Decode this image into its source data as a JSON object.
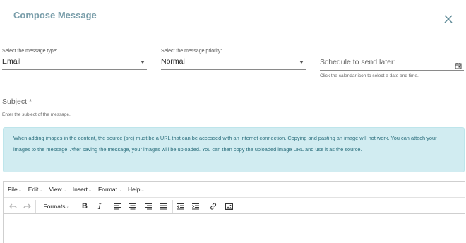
{
  "dialog": {
    "title": "Compose Message"
  },
  "message_type": {
    "label": "Select the message type:",
    "value": "Email"
  },
  "priority": {
    "label": "Select the message priority:",
    "value": "Normal"
  },
  "schedule": {
    "label": "Schedule to send later:",
    "help": "Click the calendar icon to select a date and time."
  },
  "subject": {
    "label": "Subject *",
    "help": "Enter the subject of the message."
  },
  "notice": {
    "text": "When adding images in the content, the source (src) must be a URL that can be accessed with an internet connection. Copying and pasting an image will not work. You can attach your images to the message. After saving the message, your images will be uploaded. You can then copy the uploaded image URL and use it as the source."
  },
  "editor": {
    "menus": [
      "File",
      "Edit",
      "View",
      "Insert",
      "Format",
      "Help"
    ],
    "formats_label": "Formats",
    "bold_label": "B",
    "italic_label": "I"
  }
}
